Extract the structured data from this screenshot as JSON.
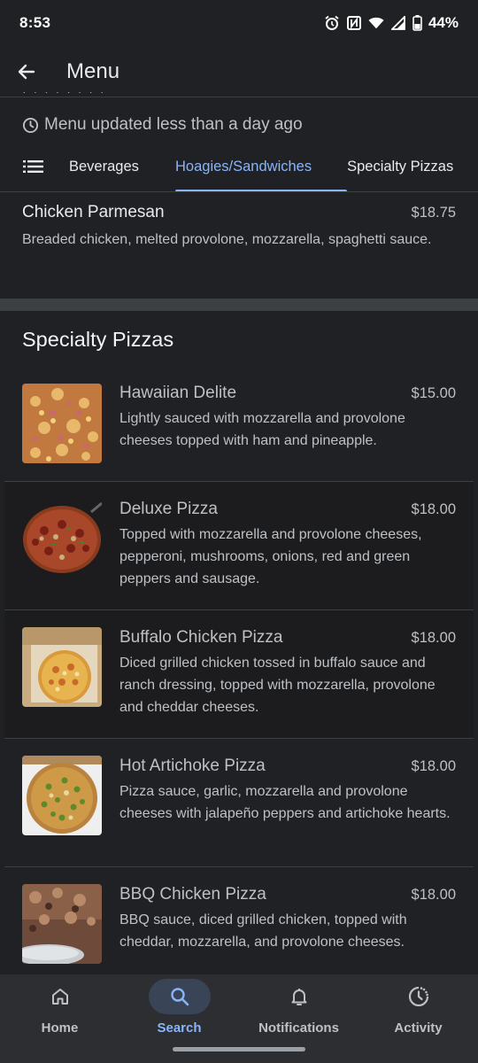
{
  "status_bar": {
    "time": "8:53",
    "battery": "44%",
    "icons": [
      "alarm-icon",
      "nfc-icon",
      "wifi-icon",
      "signal-icon",
      "battery-icon"
    ]
  },
  "app_bar": {
    "title": "Menu"
  },
  "menu_updated": "Menu updated less than a day ago",
  "tabs": [
    {
      "label": "Beverages"
    },
    {
      "label": "Hoagies/Sandwiches",
      "active": true
    },
    {
      "label": "Specialty Pizzas"
    }
  ],
  "first_item": {
    "name": "Chicken Parmesan",
    "price": "$18.75",
    "description": "Breaded chicken, melted provolone, mozzarella, spaghetti sauce."
  },
  "section": {
    "title": "Specialty Pizzas",
    "items": [
      {
        "name": "Hawaiian Delite",
        "price": "$15.00",
        "description": "Lightly sauced with mozzarella and provolone cheeses topped with ham and pineapple."
      },
      {
        "name": "Deluxe Pizza",
        "price": "$18.00",
        "description": "Topped with mozzarella and provolone cheeses, pepperoni, mushrooms, onions, red and green peppers and sausage."
      },
      {
        "name": "Buffalo Chicken Pizza",
        "price": "$18.00",
        "description": "Diced grilled chicken tossed in buffalo sauce and ranch dressing, topped with mozzarella, provolone and cheddar cheeses."
      },
      {
        "name": "Hot Artichoke Pizza",
        "price": "$18.00",
        "description": "Pizza sauce, garlic, mozzarella and provolone cheeses with jalapeño peppers and artichoke hearts."
      },
      {
        "name": "BBQ Chicken Pizza",
        "price": "$18.00",
        "description": "BBQ sauce, diced grilled chicken, topped with cheddar, mozzarella, and provolone cheeses."
      }
    ]
  },
  "bottom_nav": [
    {
      "label": "Home",
      "icon": "home-icon"
    },
    {
      "label": "Search",
      "icon": "search-icon",
      "active": true
    },
    {
      "label": "Notifications",
      "icon": "bell-icon"
    },
    {
      "label": "Activity",
      "icon": "activity-icon"
    }
  ],
  "colors": {
    "background": "#202124",
    "accent": "#8ab4f8",
    "divider": "#3c4043",
    "nav_background": "#2d2e31"
  }
}
